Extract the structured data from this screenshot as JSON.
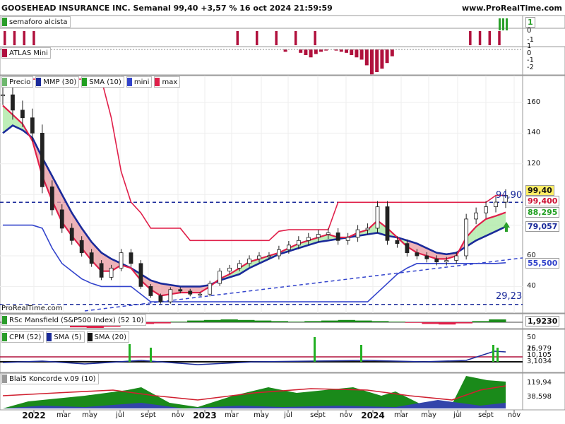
{
  "header": {
    "title": "GOOSEHEAD INSURANCE INC. Semanal 99,40 +3,57 % 16 oct 2024 21:59:59",
    "site": "www.ProRealTime.com"
  },
  "watermark": "ProRealTime.com",
  "x_axis_labels": [
    {
      "label": "2022",
      "year": true
    },
    {
      "label": "mar",
      "year": false
    },
    {
      "label": "may",
      "year": false
    },
    {
      "label": "jul",
      "year": false
    },
    {
      "label": "sept",
      "year": false
    },
    {
      "label": "nov",
      "year": false
    },
    {
      "label": "2023",
      "year": true
    },
    {
      "label": "mar",
      "year": false
    },
    {
      "label": "may",
      "year": false
    },
    {
      "label": "jul",
      "year": false
    },
    {
      "label": "sept",
      "year": false
    },
    {
      "label": "nov",
      "year": false
    },
    {
      "label": "2024",
      "year": true
    },
    {
      "label": "mar",
      "year": false
    },
    {
      "label": "may",
      "year": false
    },
    {
      "label": "jul",
      "year": false
    },
    {
      "label": "sept",
      "year": false
    },
    {
      "label": "nov",
      "year": false
    }
  ],
  "panels": {
    "semaforo": {
      "legend": [
        {
          "label": "semaforo alcista",
          "color": "#2a9d2a"
        }
      ],
      "ticks": [
        "1",
        "0",
        "-1"
      ],
      "value_tag": "1",
      "value_color": "#2aa02a",
      "red_bar_groups": [
        [
          0,
          3
        ],
        [
          24,
          32
        ],
        [
          48,
          51
        ]
      ],
      "green_bars_last": 3
    },
    "atlas": {
      "legend": [
        {
          "label": "ATLAS Mini",
          "color": "#b01040"
        }
      ],
      "ticks": [
        "1",
        "0",
        "-1",
        "-2"
      ],
      "value_tag": "0",
      "values": [
        0,
        0,
        0,
        -0.2,
        0,
        0,
        -0.3,
        -0.5,
        -0.7,
        -0.4,
        -0.2,
        -0.1,
        0,
        -0.1,
        -0.2,
        -0.3,
        -0.5,
        -0.7,
        -0.9,
        -1.4,
        -2.2,
        -2.0,
        -1.7,
        -1.2,
        -0.6
      ]
    },
    "price": {
      "legend": [
        {
          "label": "Precio",
          "color": "#6fb86f"
        },
        {
          "label": "MMP (30)",
          "color": "#1a2a9a"
        },
        {
          "label": "SMA (10)",
          "color": "#22a022"
        },
        {
          "label": "mini",
          "color": "#3344cc"
        },
        {
          "label": "max",
          "color": "#e0204a"
        }
      ],
      "ticks": [
        160,
        140,
        120,
        100,
        80,
        60,
        40
      ],
      "resistance_label": "94,90",
      "support_label": "29,23",
      "value_tags": [
        {
          "label": "99,40",
          "bg": "#ffee66",
          "color": "#111"
        },
        {
          "label": "99,400",
          "bg": "#ffffff",
          "color": "#cc1133"
        },
        {
          "label": "88,295",
          "bg": "#ffffff",
          "color": "#22a022"
        },
        {
          "label": "79,057",
          "bg": "#ffffff",
          "color": "#1a2a9a"
        },
        {
          "label": "55,500",
          "bg": "#ffffff",
          "color": "#3344cc"
        }
      ]
    },
    "rsc": {
      "legend": [
        {
          "label": "RSc Mansfield (S&P500 Index) (52 10)",
          "color": "#2a9d2a"
        }
      ],
      "value_tag": "1,9230"
    },
    "cpm": {
      "legend": [
        {
          "label": "CPM (52)",
          "color": "#2a9d2a"
        },
        {
          "label": "SMA (5)",
          "color": "#1a2a9a"
        },
        {
          "label": "SMA (20)",
          "color": "#111111"
        }
      ],
      "ticks": [
        "50",
        "25"
      ],
      "value_tags": [
        "16,979",
        "10,105",
        "3,1034"
      ]
    },
    "koncorde": {
      "legend": [
        {
          "label": "Blai5 Koncorde v.09 (10)",
          "color": "#999999"
        }
      ],
      "value_tags": [
        "119,94",
        "38,598"
      ]
    }
  },
  "chart_data": {
    "type": "line",
    "title": "GOOSEHEAD INSURANCE INC. Semanal 99,40 +3,57 % 16 oct 2024 21:59:59",
    "frequency": "weekly",
    "ylim": [
      25,
      180
    ],
    "last_close": 99.4,
    "change_pct": 3.57,
    "x": [
      "2022",
      "mar",
      "may",
      "jul",
      "sept",
      "nov",
      "2023",
      "mar",
      "may",
      "jul",
      "sept",
      "nov",
      "2024",
      "mar",
      "may",
      "jul",
      "sept",
      "nov"
    ],
    "series": [
      {
        "name": "Precio",
        "values": [
          165,
          155,
          150,
          140,
          105,
          90,
          78,
          70,
          62,
          55,
          46,
          52,
          62,
          55,
          40,
          34,
          30,
          38,
          37,
          35,
          35,
          42,
          50,
          52,
          55,
          58,
          60,
          60,
          64,
          67,
          70,
          72,
          74,
          75,
          70,
          72,
          77,
          78,
          92,
          70,
          68,
          62,
          60,
          58,
          56,
          57,
          60,
          84,
          88,
          92,
          95,
          99.4
        ]
      },
      {
        "name": "MMP (30)",
        "values": [
          140,
          145,
          142,
          137,
          124,
          112,
          100,
          88,
          78,
          69,
          62,
          58,
          55,
          52,
          48,
          44,
          42,
          41,
          40,
          40,
          40,
          41,
          44,
          46,
          48,
          52,
          55,
          58,
          61,
          63,
          65,
          67,
          69,
          70,
          71,
          72,
          73,
          74,
          75,
          73,
          72,
          70,
          68,
          65,
          62,
          61,
          62,
          66,
          70,
          73,
          76,
          79.06
        ]
      },
      {
        "name": "SMA (10)",
        "values": [
          158,
          152,
          146,
          135,
          112,
          96,
          82,
          73,
          65,
          57,
          50,
          50,
          54,
          52,
          44,
          38,
          34,
          35,
          36,
          36,
          36,
          40,
          45,
          48,
          52,
          56,
          58,
          60,
          62,
          65,
          68,
          70,
          72,
          74,
          72,
          72,
          75,
          77,
          83,
          78,
          72,
          66,
          62,
          60,
          58,
          58,
          60,
          72,
          79,
          84,
          86,
          88.3
        ]
      },
      {
        "name": "mini",
        "values": [
          80,
          80,
          80,
          80,
          78,
          65,
          55,
          50,
          45,
          42,
          40,
          40,
          40,
          40,
          35,
          30,
          30,
          30,
          30,
          30,
          30,
          30,
          30,
          30,
          30,
          30,
          30,
          30,
          30,
          30,
          30,
          30,
          30,
          30,
          30,
          30,
          30,
          30,
          36,
          42,
          48,
          52,
          55,
          55,
          55,
          55,
          55,
          55,
          55,
          55,
          55,
          55.5
        ]
      },
      {
        "name": "max",
        "values": [
          180,
          180,
          180,
          180,
          180,
          180,
          180,
          180,
          180,
          180,
          175,
          150,
          115,
          95,
          88,
          78,
          78,
          78,
          78,
          70,
          70,
          70,
          70,
          70,
          70,
          70,
          70,
          70,
          76,
          77,
          77,
          77,
          77,
          77,
          94.9,
          94.9,
          94.9,
          94.9,
          94.9,
          94.9,
          94.9,
          94.9,
          94.9,
          94.9,
          94.9,
          94.9,
          94.9,
          94.9,
          94.9,
          94.9,
          99.4,
          99.4
        ]
      }
    ]
  }
}
